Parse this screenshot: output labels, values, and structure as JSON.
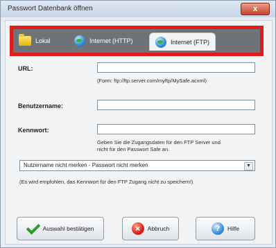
{
  "window": {
    "title": "Passwort Datenbank öffnen",
    "close_symbol": "x"
  },
  "tabs": [
    {
      "label": "Lokal",
      "icon": "folder-icon",
      "active": false
    },
    {
      "label": "Internet (HTTP)",
      "icon": "globe-icon",
      "active": false
    },
    {
      "label": "Internet (FTP)",
      "icon": "globe-icon",
      "active": true
    }
  ],
  "form": {
    "url_label": "URL:",
    "url_value": "",
    "url_hint": "(Form: ftp://ftp.server.com/myftp/MySafe.acxml)",
    "username_label": "Benutzername:",
    "username_value": "",
    "password_label": "Kennwort:",
    "password_value": "",
    "password_hint_line1": "Geben Sie die Zugangsdaten für den FTP Server und",
    "password_hint_line2": "nicht für den Passwort Safe an.",
    "remember_select": "Nutzername nicht merken - Passwort nicht merken",
    "recommendation": "(Es wird empfohlen, das Kennwort für den FTP Zugang nicht zu speichern!)"
  },
  "buttons": {
    "confirm_label": "Auswahl bestätigen",
    "cancel_label": "Abbruch",
    "help_label": "Hilfe",
    "cancel_symbol": "×",
    "help_symbol": "?"
  },
  "colors": {
    "highlight_border": "#e01b1b",
    "tabstrip_bg": "#6f7378"
  }
}
